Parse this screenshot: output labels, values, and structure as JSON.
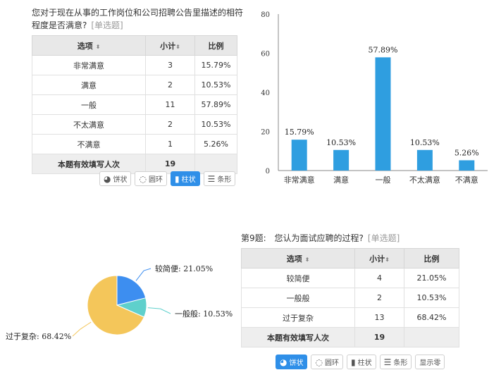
{
  "q8": {
    "title_line1": "您对于现在从事的工作岗位和公司招聘公告里描述的相符",
    "title_line2": "程度是否满意?",
    "type_tag": "[单选题]",
    "table": {
      "headers": [
        "选项",
        "小计",
        "比例"
      ],
      "rows": [
        {
          "option": "非常满意",
          "count": "3",
          "pct": "15.79%"
        },
        {
          "option": "满意",
          "count": "2",
          "pct": "10.53%"
        },
        {
          "option": "一般",
          "count": "11",
          "pct": "57.89%"
        },
        {
          "option": "不太满意",
          "count": "2",
          "pct": "10.53%"
        },
        {
          "option": "不满意",
          "count": "1",
          "pct": "5.26%"
        }
      ],
      "total_label": "本题有效填写人次",
      "total_count": "19"
    },
    "buttons": [
      {
        "label": "饼状",
        "icon": "pie-icon",
        "active": false
      },
      {
        "label": "圆环",
        "icon": "ring-icon",
        "active": false
      },
      {
        "label": "柱状",
        "icon": "bar-icon",
        "active": true
      },
      {
        "label": "条形",
        "icon": "hbar-icon",
        "active": false
      }
    ]
  },
  "q9": {
    "number": "第9题:",
    "title": "您认为面试应聘的过程?",
    "type_tag": "[单选题]",
    "table": {
      "headers": [
        "选项",
        "小计",
        "比例"
      ],
      "rows": [
        {
          "option": "较简便",
          "count": "4",
          "pct": "21.05%"
        },
        {
          "option": "一般般",
          "count": "2",
          "pct": "10.53%"
        },
        {
          "option": "过于复杂",
          "count": "13",
          "pct": "68.42%"
        }
      ],
      "total_label": "本题有效填写人次",
      "total_count": "19"
    },
    "buttons": [
      {
        "label": "饼状",
        "icon": "pie-icon",
        "active": true
      },
      {
        "label": "圆环",
        "icon": "ring-icon",
        "active": false
      },
      {
        "label": "柱状",
        "icon": "bar-icon",
        "active": false
      },
      {
        "label": "条形",
        "icon": "hbar-icon",
        "active": false
      },
      {
        "label": "显示零",
        "icon": "",
        "active": false
      }
    ]
  },
  "chart_data": [
    {
      "type": "bar",
      "categories": [
        "非常满意",
        "满意",
        "一般",
        "不太满意",
        "不满意"
      ],
      "values": [
        15.79,
        10.53,
        57.89,
        10.53,
        5.26
      ],
      "data_labels": [
        "15.79%",
        "10.53%",
        "57.89%",
        "10.53%",
        "5.26%"
      ],
      "yticks": [
        "0",
        "20",
        "40",
        "60",
        "80"
      ],
      "ylim": [
        0,
        80
      ],
      "color": "#2f9ee0"
    },
    {
      "type": "pie",
      "labels": [
        "较简便",
        "一般般",
        "过于复杂"
      ],
      "values": [
        21.05,
        10.53,
        68.42
      ],
      "data_labels": [
        "较简便: 21.05%",
        "一般般: 10.53%",
        "过于复杂: 68.42%"
      ],
      "colors": [
        "#3d8ef0",
        "#5fd0cc",
        "#f4c65a"
      ]
    }
  ]
}
